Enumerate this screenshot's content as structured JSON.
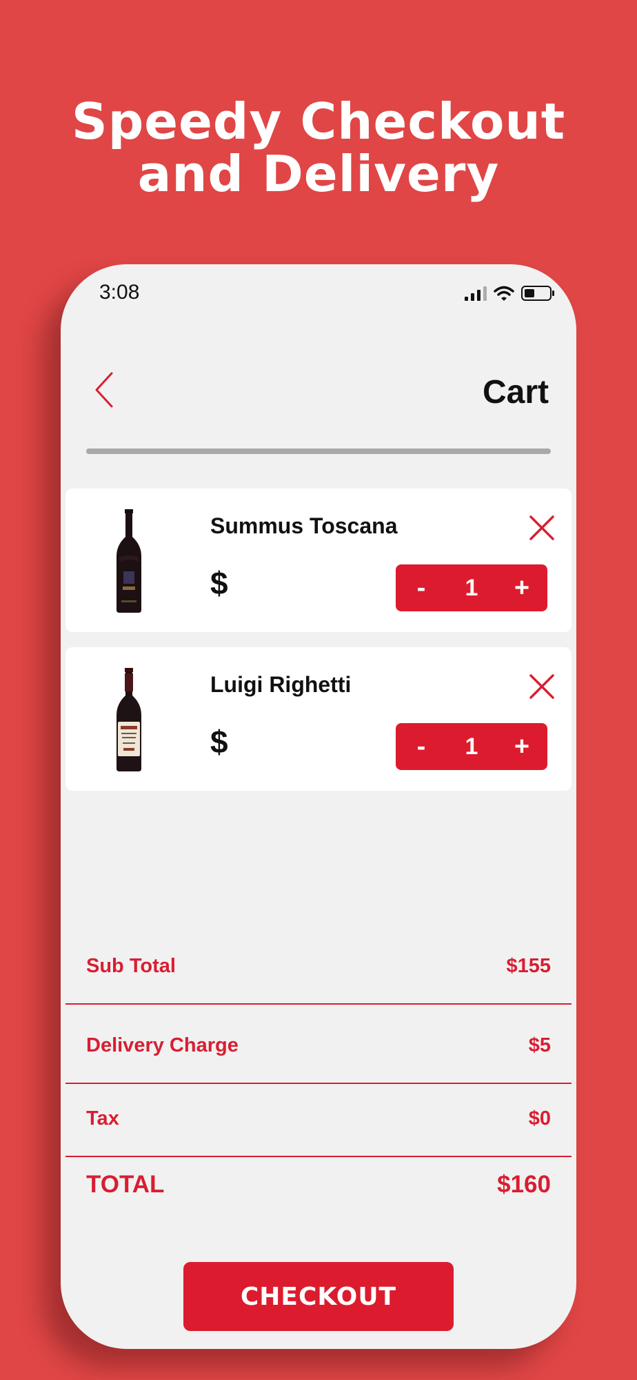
{
  "headline": {
    "line1": "Speedy Checkout",
    "line2": "and Delivery"
  },
  "status_bar": {
    "time": "3:08",
    "icons": [
      "signal-icon",
      "wifi-icon",
      "battery-icon"
    ]
  },
  "header": {
    "title": "Cart",
    "back_icon": "chevron-left-icon"
  },
  "cart_items": [
    {
      "name": "Summus Toscana",
      "price": "$",
      "quantity": "1",
      "minus": "-",
      "plus": "+",
      "remove_icon": "close-icon"
    },
    {
      "name": "Luigi Righetti",
      "price": "$",
      "quantity": "1",
      "minus": "-",
      "plus": "+",
      "remove_icon": "close-icon"
    }
  ],
  "summary": {
    "subtotal": {
      "label": "Sub Total",
      "value": "$155"
    },
    "delivery": {
      "label": "Delivery Charge",
      "value": "$5"
    },
    "tax": {
      "label": "Tax",
      "value": "$0"
    },
    "total": {
      "label": "TOTAL",
      "value": "$160"
    }
  },
  "checkout_label": "CHECKOUT",
  "colors": {
    "background": "#e04646",
    "accent": "#dc1c2e",
    "phone": "#f1f1f1",
    "divider": "#a9a9a9"
  }
}
